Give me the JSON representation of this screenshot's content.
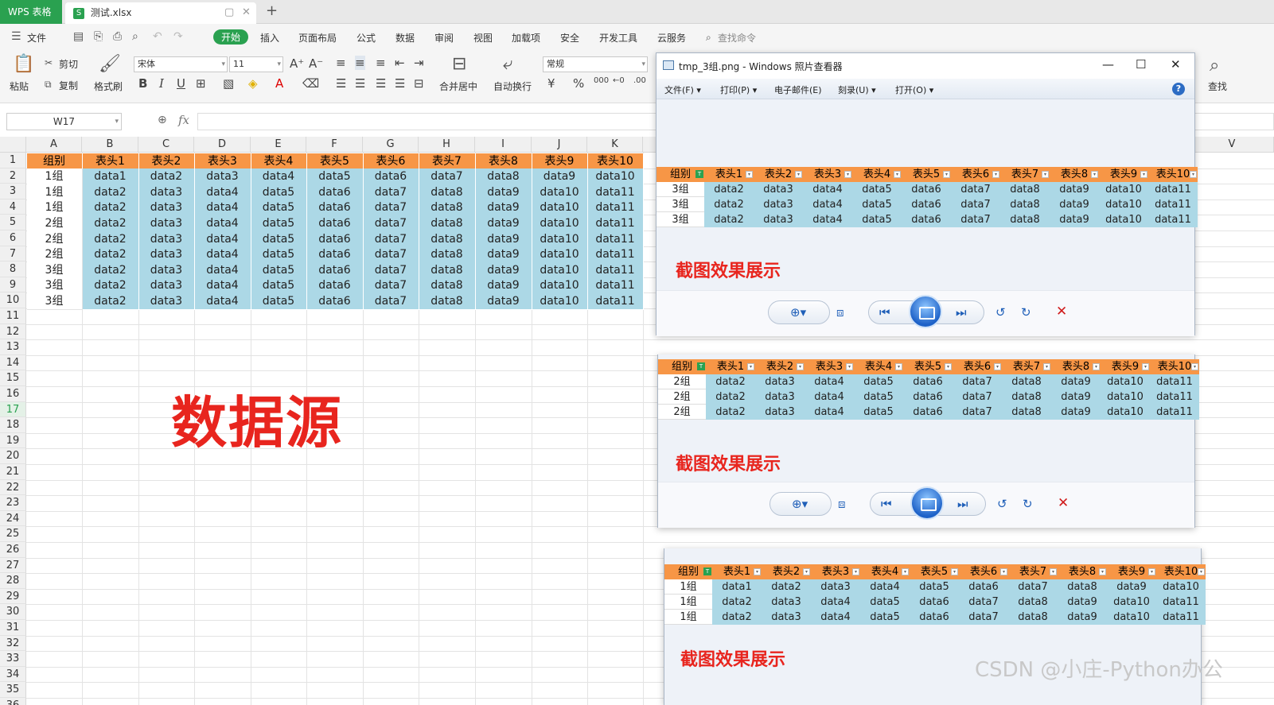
{
  "titlebar": {
    "app_tab": "WPS 表格",
    "file_tab": "测试.xlsx",
    "file_icon": "S",
    "new_tab": "+",
    "pin_glyph": "▢",
    "close_glyph": "✕"
  },
  "menu": {
    "file": "文件",
    "items": [
      "开始",
      "插入",
      "页面布局",
      "公式",
      "数据",
      "审阅",
      "视图",
      "加载项",
      "安全",
      "开发工具",
      "云服务"
    ],
    "search": "查找命令"
  },
  "ribbon": {
    "paste": "粘贴",
    "cut": "剪切",
    "copy": "复制",
    "format_painter": "格式刷",
    "font_name": "宋体",
    "font_size": "11",
    "number_format": "常规",
    "merge_center": "合并居中",
    "wrap_text": "自动换行",
    "find": "查找",
    "bold": "B",
    "italic": "I",
    "underline": "U"
  },
  "formula_bar": {
    "name_box": "W17",
    "fx": "fx",
    "value": ""
  },
  "sheet": {
    "columns": [
      "A",
      "B",
      "C",
      "D",
      "E",
      "F",
      "G",
      "H",
      "I",
      "J",
      "K"
    ],
    "right_column": "V",
    "rows": [
      "1",
      "2",
      "3",
      "4",
      "5",
      "6",
      "7",
      "8",
      "9",
      "10",
      "11",
      "12",
      "13",
      "14",
      "15",
      "16",
      "17",
      "18",
      "19",
      "20",
      "21",
      "22",
      "23",
      "24",
      "25",
      "26",
      "27",
      "28",
      "29",
      "30",
      "31",
      "32",
      "33",
      "34",
      "35",
      "36"
    ],
    "selected_row": "17",
    "header": [
      "组别",
      "表头1",
      "表头2",
      "表头3",
      "表头4",
      "表头5",
      "表头6",
      "表头7",
      "表头8",
      "表头9",
      "表头10"
    ],
    "data": [
      [
        "1组",
        "data1",
        "data2",
        "data3",
        "data4",
        "data5",
        "data6",
        "data7",
        "data8",
        "data9",
        "data10"
      ],
      [
        "1组",
        "data2",
        "data3",
        "data4",
        "data5",
        "data6",
        "data7",
        "data8",
        "data9",
        "data10",
        "data11"
      ],
      [
        "1组",
        "data2",
        "data3",
        "data4",
        "data5",
        "data6",
        "data7",
        "data8",
        "data9",
        "data10",
        "data11"
      ],
      [
        "2组",
        "data2",
        "data3",
        "data4",
        "data5",
        "data6",
        "data7",
        "data8",
        "data9",
        "data10",
        "data11"
      ],
      [
        "2组",
        "data2",
        "data3",
        "data4",
        "data5",
        "data6",
        "data7",
        "data8",
        "data9",
        "data10",
        "data11"
      ],
      [
        "2组",
        "data2",
        "data3",
        "data4",
        "data5",
        "data6",
        "data7",
        "data8",
        "data9",
        "data10",
        "data11"
      ],
      [
        "3组",
        "data2",
        "data3",
        "data4",
        "data5",
        "data6",
        "data7",
        "data8",
        "data9",
        "data10",
        "data11"
      ],
      [
        "3组",
        "data2",
        "data3",
        "data4",
        "data5",
        "data6",
        "data7",
        "data8",
        "data9",
        "data10",
        "data11"
      ],
      [
        "3组",
        "data2",
        "data3",
        "data4",
        "data5",
        "data6",
        "data7",
        "data8",
        "data9",
        "data10",
        "data11"
      ]
    ],
    "source_label": "数据源"
  },
  "viewer": {
    "title": "tmp_3组.png - Windows 照片查看器",
    "menus": [
      "文件(F)",
      "打印(P)",
      "电子邮件(E)",
      "刻录(U)",
      "打开(O)"
    ],
    "help": "?",
    "caption": "截图效果展示",
    "group3_rows": [
      [
        "3组",
        "data2",
        "data3",
        "data4",
        "data5",
        "data6",
        "data7",
        "data8",
        "data9",
        "data10",
        "data11"
      ],
      [
        "3组",
        "data2",
        "data3",
        "data4",
        "data5",
        "data6",
        "data7",
        "data8",
        "data9",
        "data10",
        "data11"
      ],
      [
        "3组",
        "data2",
        "data3",
        "data4",
        "data5",
        "data6",
        "data7",
        "data8",
        "data9",
        "data10",
        "data11"
      ]
    ],
    "group2_rows": [
      [
        "2组",
        "data2",
        "data3",
        "data4",
        "data5",
        "data6",
        "data7",
        "data8",
        "data9",
        "data10",
        "data11"
      ],
      [
        "2组",
        "data2",
        "data3",
        "data4",
        "data5",
        "data6",
        "data7",
        "data8",
        "data9",
        "data10",
        "data11"
      ],
      [
        "2组",
        "data2",
        "data3",
        "data4",
        "data5",
        "data6",
        "data7",
        "data8",
        "data9",
        "data10",
        "data11"
      ]
    ],
    "group1_rows": [
      [
        "1组",
        "data1",
        "data2",
        "data3",
        "data4",
        "data5",
        "data6",
        "data7",
        "data8",
        "data9",
        "data10"
      ],
      [
        "1组",
        "data2",
        "data3",
        "data4",
        "data5",
        "data6",
        "data7",
        "data8",
        "data9",
        "data10",
        "data11"
      ],
      [
        "1组",
        "data2",
        "data3",
        "data4",
        "data5",
        "data6",
        "data7",
        "data8",
        "data9",
        "data10",
        "data11"
      ]
    ]
  },
  "watermark": "CSDN @小庄-Python办公",
  "colors": {
    "accent": "#2aa150",
    "header_fill": "#f79646",
    "body_fill": "#acd8e6",
    "caption": "#e8251e"
  }
}
